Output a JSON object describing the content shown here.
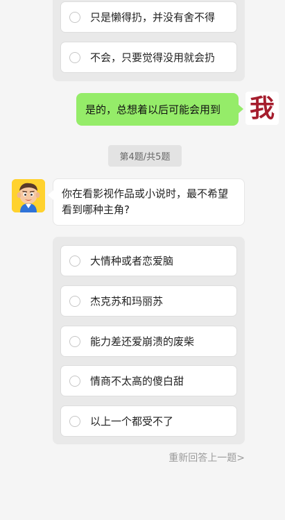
{
  "prev_question": {
    "options": [
      "只是懒得扔，并没有舍不得",
      "不会，只要觉得没用就会扔"
    ]
  },
  "user_reply": {
    "text": "是的，总想着以后可能会用到",
    "avatar_text": "我"
  },
  "progress": {
    "label": "第4题/共5题"
  },
  "question": {
    "text": "你在看影视作品或小说时，最不希望看到哪种主角?"
  },
  "options": [
    "大情种或者恋爱脑",
    "杰克苏和玛丽苏",
    "能力差还爱崩溃的废柴",
    "情商不太高的傻白甜",
    "以上一个都受不了"
  ],
  "actions": {
    "redo_label": "重新回答上一题>"
  }
}
